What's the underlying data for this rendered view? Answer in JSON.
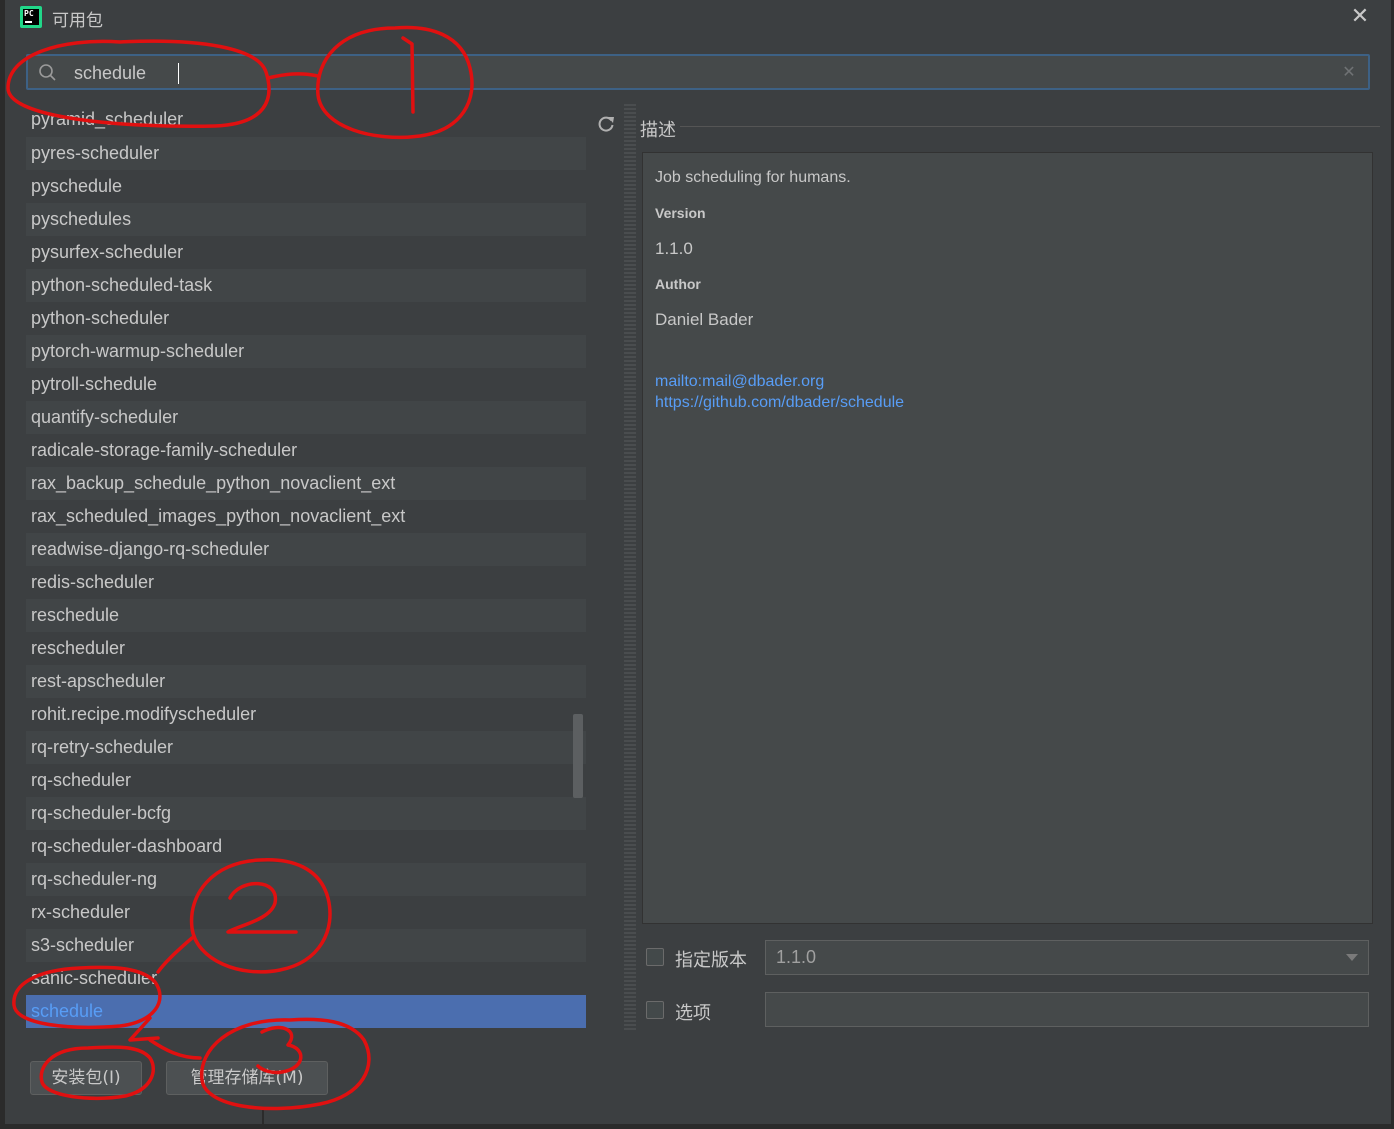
{
  "window": {
    "title": "可用包"
  },
  "search": {
    "value": "schedule"
  },
  "packages": [
    "pyramid_scheduler",
    "pyres-scheduler",
    "pyschedule",
    "pyschedules",
    "pysurfex-scheduler",
    "python-scheduled-task",
    "python-scheduler",
    "pytorch-warmup-scheduler",
    "pytroll-schedule",
    "quantify-scheduler",
    "radicale-storage-family-scheduler",
    "rax_backup_schedule_python_novaclient_ext",
    "rax_scheduled_images_python_novaclient_ext",
    "readwise-django-rq-scheduler",
    "redis-scheduler",
    "reschedule",
    "rescheduler",
    "rest-apscheduler",
    "rohit.recipe.modifyscheduler",
    "rq-retry-scheduler",
    "rq-scheduler",
    "rq-scheduler-bcfg",
    "rq-scheduler-dashboard",
    "rq-scheduler-ng",
    "rx-scheduler",
    "s3-scheduler",
    "sanic-scheduler",
    "schedule"
  ],
  "selected_package": "schedule",
  "description": {
    "label": "描述",
    "summary": "Job scheduling for humans.",
    "version_heading": "Version",
    "version": "1.1.0",
    "author_heading": "Author",
    "author": "Daniel Bader",
    "links": [
      "mailto:mail@dbader.org",
      "https://github.com/dbader/schedule"
    ]
  },
  "options": {
    "specify_version_label": "指定版本",
    "specify_version_value": "1.1.0",
    "options_label": "选项"
  },
  "buttons": {
    "install": "安装包(I)",
    "manage_repos": "管理存储库(M)"
  },
  "annotations": {
    "n1": "1",
    "n2": "2",
    "n3": "3"
  },
  "colors": {
    "selection": "#4b6eaf",
    "link": "#589df6",
    "annotation": "#e01010",
    "focus": "#3d6185"
  }
}
